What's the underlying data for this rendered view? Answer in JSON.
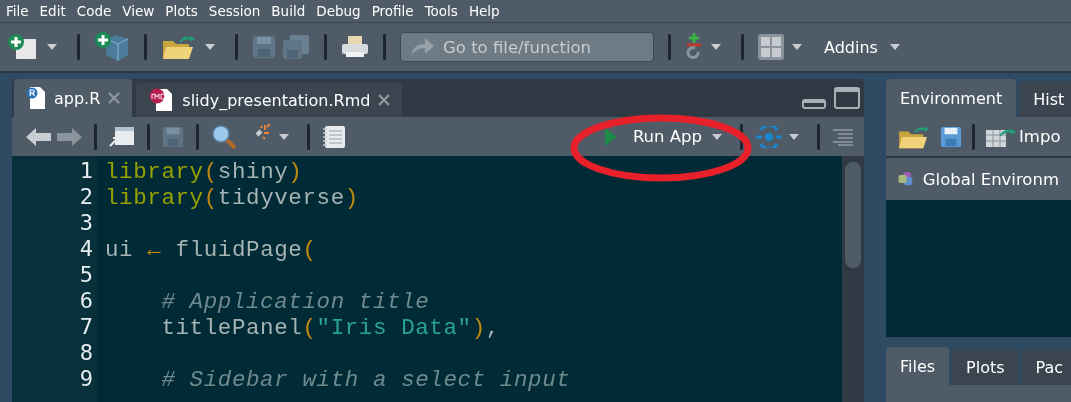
{
  "menu": [
    "File",
    "Edit",
    "Code",
    "View",
    "Plots",
    "Session",
    "Build",
    "Debug",
    "Profile",
    "Tools",
    "Help"
  ],
  "toolbar": {
    "goto": {
      "placeholder": "Go to file/function"
    },
    "addins": "Addins"
  },
  "editor": {
    "tabs": [
      {
        "label": "app.R",
        "kind": "r",
        "selected": true
      },
      {
        "label": "slidy_presentation.Rmd",
        "kind": "rmd",
        "selected": false
      }
    ],
    "run_button": "Run App",
    "lines": [
      {
        "number": "1",
        "tokens": [
          {
            "t": "library",
            "kind": "fn"
          },
          {
            "t": "(",
            "kind": "paren"
          },
          {
            "t": "shiny",
            "kind": "plain"
          },
          {
            "t": ")",
            "kind": "paren"
          }
        ]
      },
      {
        "number": "2",
        "tokens": [
          {
            "t": "library",
            "kind": "fn"
          },
          {
            "t": "(",
            "kind": "paren"
          },
          {
            "t": "tidyverse",
            "kind": "plain"
          },
          {
            "t": ")",
            "kind": "paren"
          }
        ]
      },
      {
        "number": "3"
      },
      {
        "number": "4",
        "tokens": [
          {
            "t": "ui ",
            "kind": "plain"
          },
          {
            "t": "←",
            "kind": "op"
          },
          {
            "t": " fluidPage",
            "kind": "plain"
          },
          {
            "t": "(",
            "kind": "paren"
          }
        ]
      },
      {
        "number": "5"
      },
      {
        "number": "6",
        "tokens": [
          {
            "t": "    # Application title",
            "kind": "comment"
          }
        ]
      },
      {
        "number": "7",
        "tokens": [
          {
            "t": "    titlePanel",
            "kind": "plain"
          },
          {
            "t": "(",
            "kind": "paren"
          },
          {
            "t": "\"Iris Data\"",
            "kind": "str"
          },
          {
            "t": ")",
            "kind": "paren"
          },
          {
            "t": ",",
            "kind": "plain"
          }
        ]
      },
      {
        "number": "8"
      },
      {
        "number": "9",
        "tokens": [
          {
            "t": "    # Sidebar with a select input",
            "kind": "comment"
          }
        ]
      }
    ]
  },
  "environment_pane": {
    "tabs": [
      {
        "label": "Environment",
        "selected": true
      },
      {
        "label": "Hist",
        "selected": false
      }
    ],
    "import_label": "Impo",
    "scope": "Global Environm"
  },
  "files_pane": {
    "tabs": [
      {
        "label": "Files",
        "selected": true
      },
      {
        "label": "Plots",
        "selected": false
      },
      {
        "label": "Pac",
        "selected": false
      }
    ]
  }
}
